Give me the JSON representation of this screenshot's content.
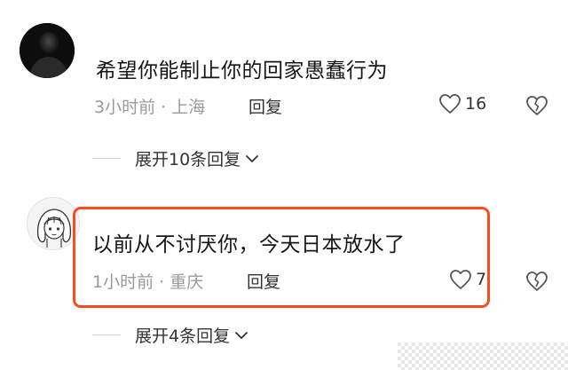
{
  "comments": [
    {
      "avatar": "dark-silhouette-avatar",
      "content": "希望你能制止你的回家愚蠢行为",
      "time": "3小时前",
      "separator": "·",
      "location": "上海",
      "reply_label": "回复",
      "like_count": "16",
      "expand_label": "展开10条回复"
    },
    {
      "avatar": "cartoon-girl-avatar",
      "content": "以前从不讨厌你，今天日本放水了",
      "time": "1小时前",
      "separator": "·",
      "location": "重庆",
      "reply_label": "回复",
      "like_count": "7",
      "expand_label": "展开4条回复",
      "highlighted": true
    }
  ],
  "colors": {
    "highlight_border": "#ff4a1c",
    "meta_text": "#9a9a9a",
    "body_text": "#161616"
  },
  "icons": [
    "heart-outline-icon",
    "broken-heart-icon",
    "chevron-down-icon"
  ]
}
